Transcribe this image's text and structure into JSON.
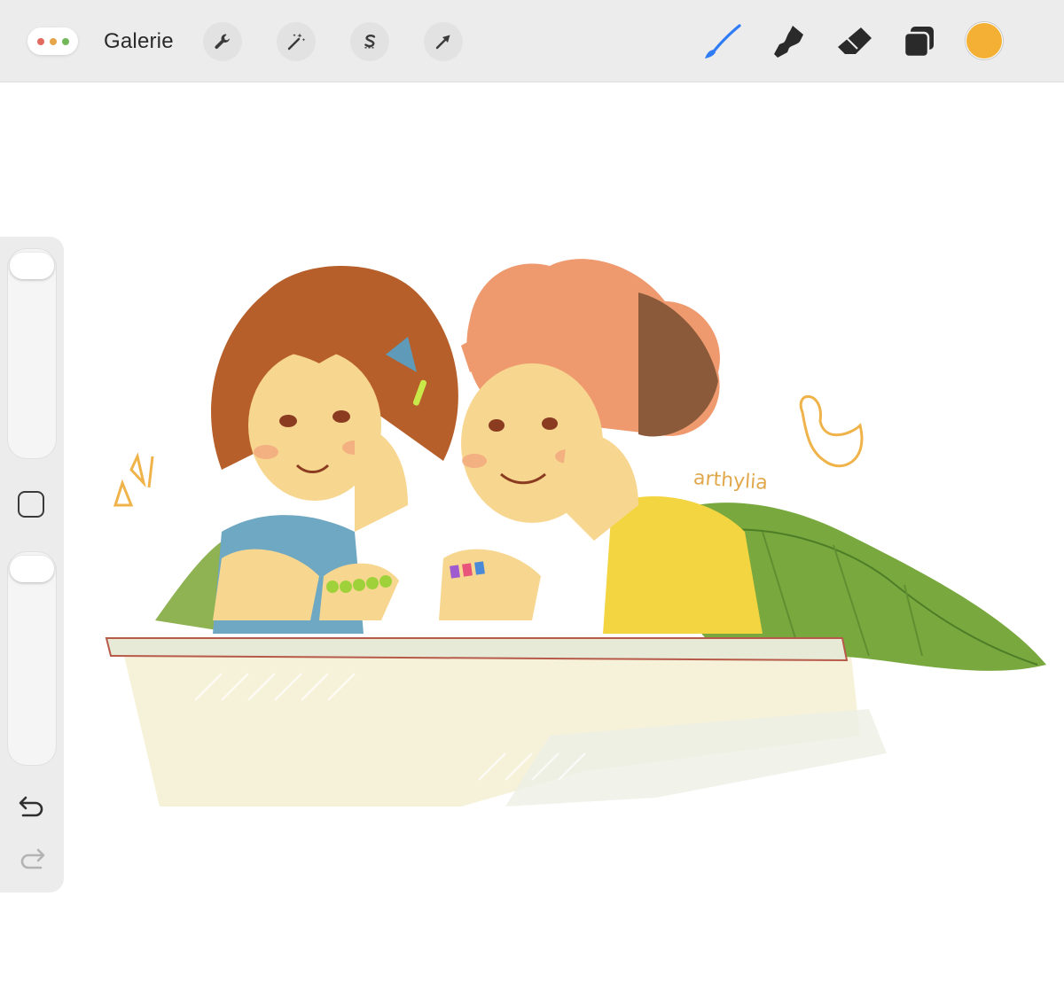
{
  "toolbar": {
    "gallery_label": "Galerie",
    "window_controls": [
      "red-dot",
      "orange-dot",
      "green-dot"
    ],
    "left_tools": [
      "wrench-icon",
      "magic-wand-icon",
      "selection-icon",
      "transform-arrow-icon"
    ],
    "right_tools": [
      {
        "name": "brush-icon",
        "active": true
      },
      {
        "name": "smudge-icon",
        "active": false
      },
      {
        "name": "eraser-icon",
        "active": false
      },
      {
        "name": "layers-icon",
        "active": false
      }
    ],
    "current_color": "#f3b034",
    "active_tool_color": "#2f7cf6"
  },
  "sidebar": {
    "brush_size": 0.99,
    "opacity": 0.99,
    "icons": [
      "modify-square-icon",
      "undo-icon",
      "redo-icon"
    ]
  },
  "canvas": {
    "artist_signature": "arthylia"
  }
}
